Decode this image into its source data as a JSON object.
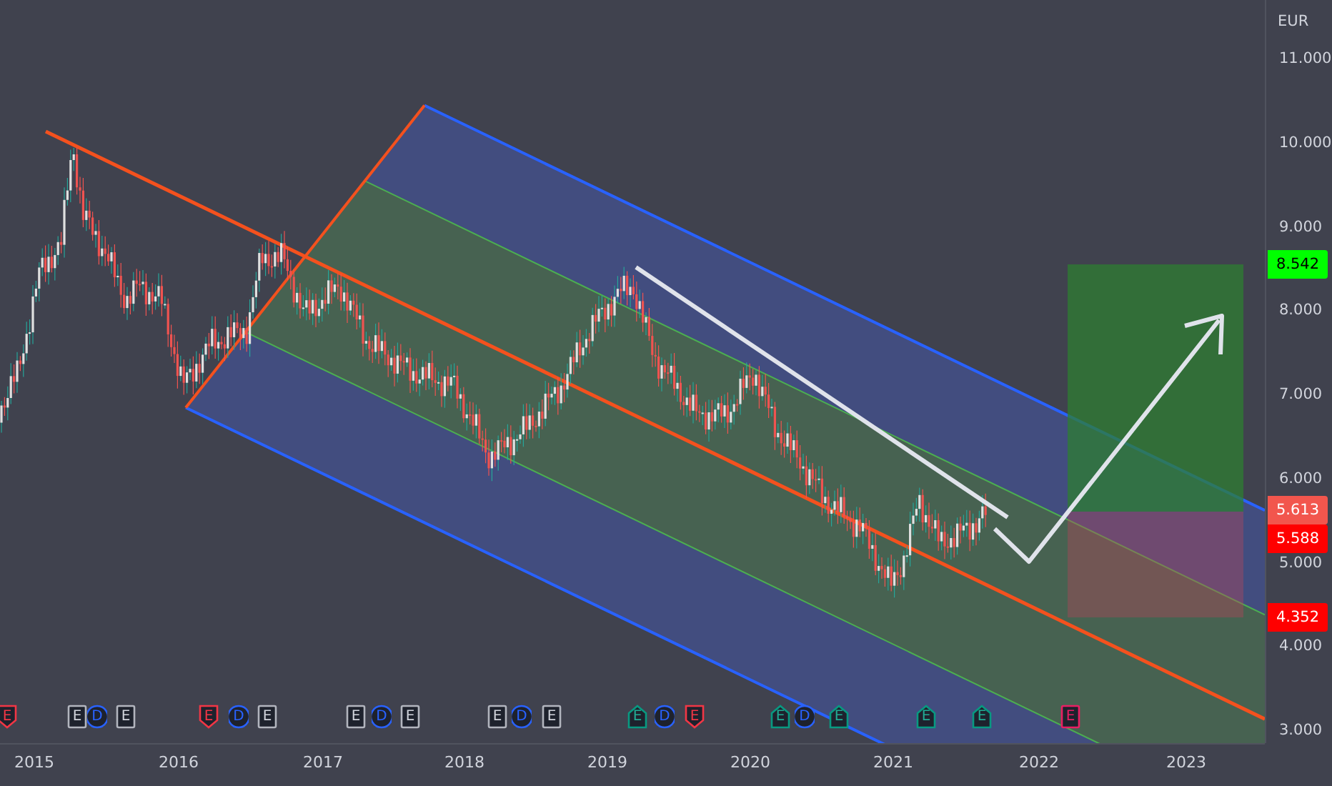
{
  "price_axis": {
    "currency": "EUR",
    "ticks": [
      "11.000",
      "10.000",
      "9.000",
      "8.000",
      "7.000",
      "6.000",
      "5.000",
      "4.000",
      "3.000"
    ]
  },
  "price_tags": [
    {
      "label": "8.542",
      "color": "#00ff00"
    },
    {
      "label": "5.613",
      "color": "#f2564d"
    },
    {
      "label": "5.588",
      "color": "#ff0000"
    },
    {
      "label": "4.352",
      "color": "#ff0000"
    }
  ],
  "time_axis": {
    "ticks": [
      "2015",
      "2016",
      "2017",
      "2018",
      "2019",
      "2020",
      "2021",
      "2022",
      "2023"
    ]
  },
  "events": [
    {
      "label": "E",
      "kind": "miss"
    },
    {
      "label": "E",
      "kind": "neutral"
    },
    {
      "label": "D",
      "kind": "dividend"
    },
    {
      "label": "E",
      "kind": "neutral"
    },
    {
      "label": "E",
      "kind": "miss"
    },
    {
      "label": "D",
      "kind": "dividend"
    },
    {
      "label": "E",
      "kind": "neutral"
    },
    {
      "label": "E",
      "kind": "neutral"
    },
    {
      "label": "D",
      "kind": "dividend"
    },
    {
      "label": "E",
      "kind": "neutral"
    },
    {
      "label": "E",
      "kind": "neutral"
    },
    {
      "label": "D",
      "kind": "dividend"
    },
    {
      "label": "E",
      "kind": "neutral"
    },
    {
      "label": "E",
      "kind": "beat"
    },
    {
      "label": "D",
      "kind": "dividend"
    },
    {
      "label": "E",
      "kind": "miss"
    },
    {
      "label": "E",
      "kind": "beat"
    },
    {
      "label": "D",
      "kind": "dividend"
    },
    {
      "label": "E",
      "kind": "beat"
    },
    {
      "label": "E",
      "kind": "beat"
    },
    {
      "label": "E",
      "kind": "beat"
    },
    {
      "label": "E",
      "kind": "upcoming"
    }
  ]
}
